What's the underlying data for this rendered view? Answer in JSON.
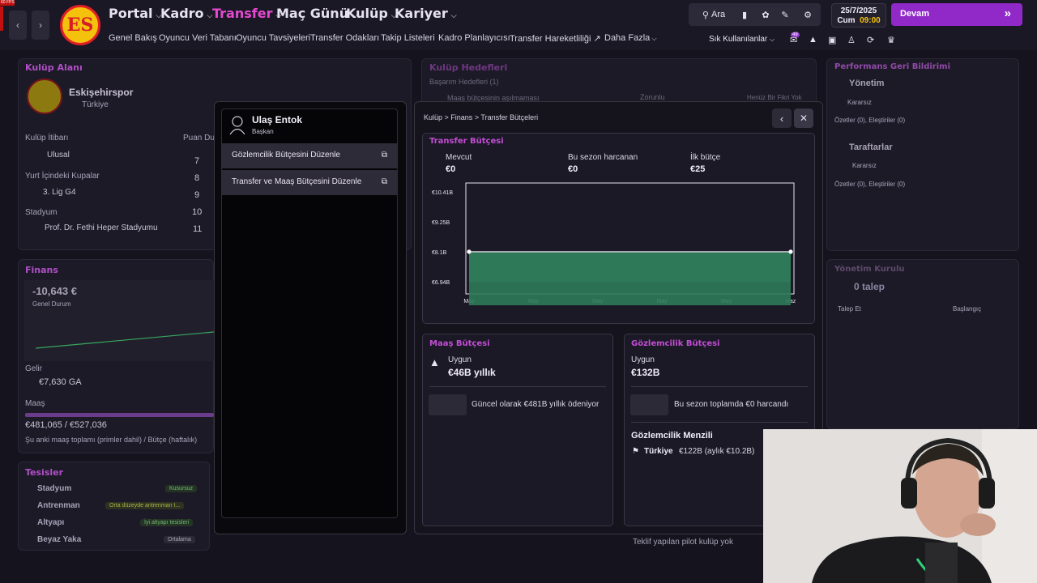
{
  "fps": "60 FPS",
  "nav": {
    "main": [
      "Portal",
      "Kadro",
      "Transfer",
      "Maç Günü",
      "Kulüp",
      "Kariyer"
    ],
    "sub": [
      "Genel Bakış",
      "Oyuncu Veri Tabanı",
      "Oyuncu Tavsiyeleri",
      "Transfer Odakları",
      "Takip Listeleri",
      "Kadro Planlayıcısı",
      "Transfer Hareketliliği",
      "Daha Fazla"
    ],
    "search": "Ara",
    "date": "25/7/2025",
    "day": "Cum",
    "time": "09:00",
    "continue": "Devam",
    "shortcuts": "Sık Kullanılanlar",
    "badge": "49"
  },
  "bg": {
    "club_area": "Kulüp Alanı",
    "club_name": "Eskişehirspor",
    "country": "Türkiye",
    "reputation_label": "Kulüp İtibarı",
    "reputation": "Ulusal",
    "cups_label": "Yurt İçindeki Kupalar",
    "cup": "3. Lig G4",
    "stadium_label": "Stadyum",
    "stadium": "Prof. Dr. Fethi Heper Stadyumu",
    "points_label": "Puan Du",
    "points": [
      "7",
      "8",
      "9",
      "10",
      "11"
    ],
    "goals_title": "Kulüp Hedefleri",
    "goals_sub": "Başarım Hedefleri",
    "goals_count": "(1)",
    "goal_item": "Maaş bütçesinin aşılmaması",
    "goal_status": "Zorunlu",
    "goal_note": "Henüz Bir Fikri Yok",
    "feedback_title": "Performans Geri Bildirimi",
    "board": "Yönetim",
    "board_status": "Kararsız",
    "board_meta": "Özetler (0),  Eleştiriler (0)",
    "fans": "Taraftarlar",
    "fans_status": "Kararsız",
    "fans_meta": "Özetler (0),  Eleştiriler (0)",
    "finance_title": "Finans",
    "balance": "-10,643 €",
    "balance_label": "Genel Durum",
    "income_label": "Gelir",
    "income": "€7,630",
    "income_unit": "GA",
    "wage_label": "Maaş",
    "wage": "€481,065 / €527,036",
    "wage_note": "Şu anki maaş toplamı (primler dahil) / Bütçe (haftalık)",
    "facilities_title": "Tesisler",
    "facilities": [
      {
        "name": "Stadyum",
        "value": "Kusursuz"
      },
      {
        "name": "Antrenman",
        "value": "Orta düzeyde antrenman t..."
      },
      {
        "name": "Altyapı",
        "value": "İyi altyapı tesisleri"
      },
      {
        "name": "Beyaz Yaka",
        "value": "Ortalama"
      }
    ],
    "committee_title": "Yönetim Kurulu",
    "requests": "0 talep",
    "col1": "Talep Et",
    "col2": "Başlangıç",
    "pilot": "Teklif yapılan pilot kulüp yok"
  },
  "person": {
    "name": "Ulaş Entok",
    "role": "Başkan",
    "menu": [
      "Gözlemcilik Bütçesini Düzenle",
      "Transfer ve Maaş Bütçesini Düzenle"
    ]
  },
  "breadcrumb": [
    "Kulüp",
    "Finans",
    "Transfer Bütçeleri"
  ],
  "transfer": {
    "title": "Transfer Bütçesi",
    "stats": [
      {
        "label": "Mevcut",
        "value": "€0"
      },
      {
        "label": "Bu sezon harcanan",
        "value": "€0"
      },
      {
        "label": "İlk bütçe",
        "value": "€25"
      }
    ]
  },
  "chart_data": {
    "type": "area",
    "ytick_labels": [
      "€10.41B",
      "€9.25B",
      "€8.1B",
      "€6.94B"
    ],
    "xtick_labels": [
      "May",
      "May",
      "May",
      "May",
      "May",
      "Haz"
    ],
    "ylim": [
      6.94,
      10.41
    ],
    "series": [
      {
        "values": [
          8.1,
          8.1,
          8.1,
          8.1,
          8.1,
          8.1
        ]
      }
    ],
    "color": "#2e7a58",
    "grid": false
  },
  "wage_budget": {
    "title": "Maaş Bütçesi",
    "status": "Uygun",
    "amount": "€46B yıllık",
    "note": "Güncel olarak €481B yıllık ödeniyor"
  },
  "scout_budget": {
    "title": "Gözlemcilik Bütçesi",
    "status": "Uygun",
    "amount": "€132B",
    "note": "Bu sezon toplamda €0 harcandı",
    "range_title": "Gözlemcilik Menzili",
    "country": "Türkiye",
    "range": "€122B (aylık €10.2B)"
  }
}
